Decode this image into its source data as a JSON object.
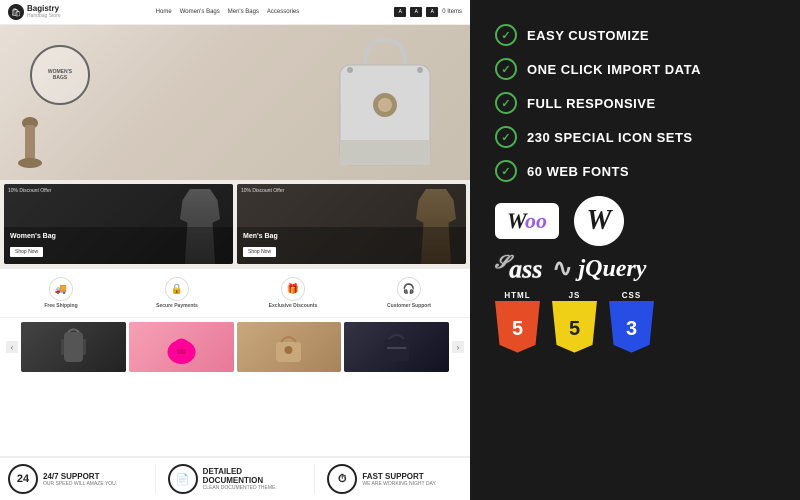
{
  "store": {
    "logo_name": "Bagistry",
    "logo_sub": "Handbag Store",
    "nav_links": [
      "Home",
      "Women's Bags",
      "Men's Bags",
      "Accessories"
    ],
    "cart_count": "0 Items",
    "hero_badge_text": "WOMEN'S\nBAGS",
    "banner1_discount": "10% Discount Offer",
    "banner1_title": "Women's Bag",
    "banner1_btn": "Shop Now",
    "banner2_discount": "10% Discount Offer",
    "banner2_title": "Men's Bag",
    "banner2_btn": "Shop Now",
    "feature_icons": [
      {
        "icon": "🚚",
        "label": "Free Shipping"
      },
      {
        "icon": "🔒",
        "label": "Secure Payments"
      },
      {
        "icon": "🎁",
        "label": "Exclusive Discounts"
      },
      {
        "icon": "🎧",
        "label": "Customer Support"
      }
    ]
  },
  "support_bar": {
    "items": [
      {
        "icon": "24",
        "title": "24/7 SUPPORT",
        "subtitle": "OUR SPEED WILL AMAZE YOU."
      },
      {
        "icon": "📄",
        "title": "DETAILED DOCUMENTION",
        "subtitle": "CLEAN DOCUMENTED THEME."
      },
      {
        "icon": "⏱",
        "title": "FAST SUPPORT",
        "subtitle": "WE ARE WORKING NIGHT DAY."
      }
    ]
  },
  "features": [
    {
      "text": "EASY CUSTOMIZE"
    },
    {
      "text": "ONE CLICK IMPORT DATA"
    },
    {
      "text": "FULL RESPONSIVE"
    },
    {
      "text": "230 SPECIAL ICON SETS"
    },
    {
      "text": "60 WEB FONTS"
    }
  ],
  "tech": {
    "woo_label": "Woo",
    "wp_label": "W",
    "sass_label": "Sass",
    "jquery_label": "jQuery",
    "html_label": "HTML",
    "html_number": "5",
    "js_label": "JS",
    "js_number": "5",
    "css_label": "CSS",
    "css_number": "3"
  }
}
